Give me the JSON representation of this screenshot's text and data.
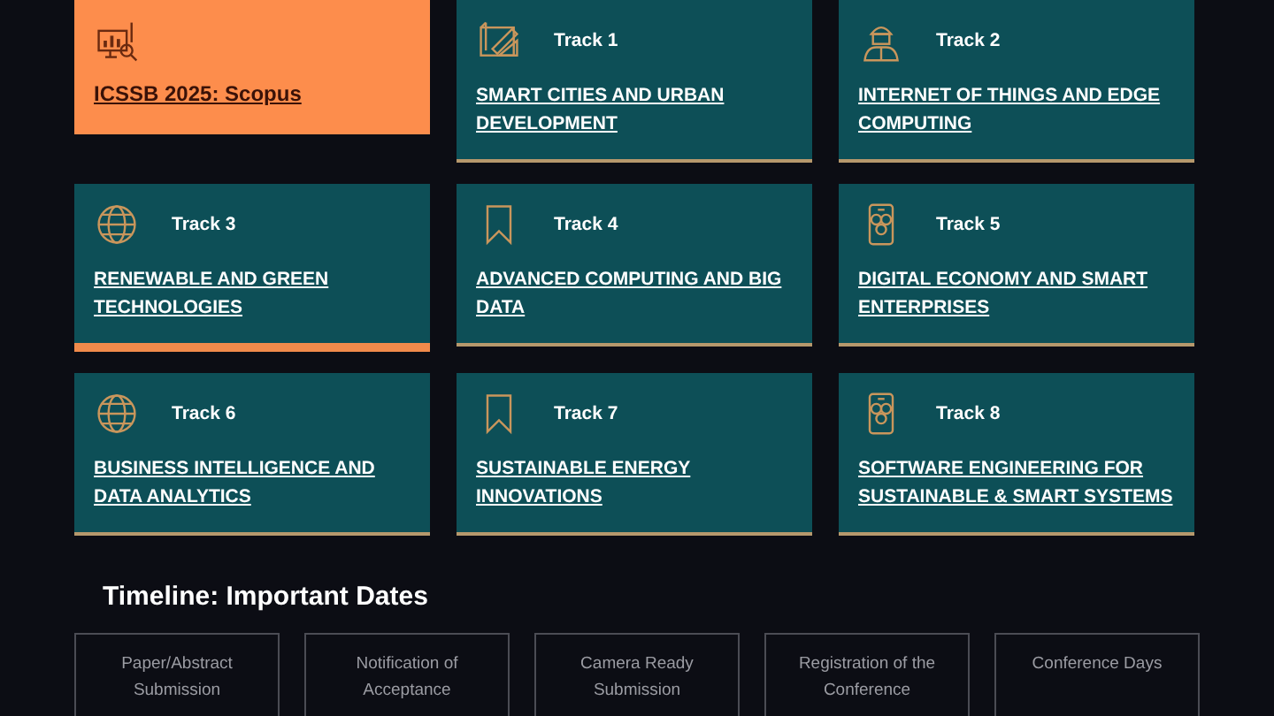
{
  "featured": {
    "title": "ICSSB 2025: Scopus"
  },
  "tracks": [
    {
      "label": "Track 1",
      "title": "SMART CITIES AND URBAN DEVELOPMENT",
      "highlighted": false
    },
    {
      "label": "Track 2",
      "title": "INTERNET OF THINGS AND EDGE COMPUTING",
      "highlighted": false
    },
    {
      "label": "Track 3",
      "title": "RENEWABLE AND GREEN TECHNOLOGIES",
      "highlighted": true
    },
    {
      "label": "Track 4",
      "title": "ADVANCED COMPUTING AND BIG DATA",
      "highlighted": false
    },
    {
      "label": "Track 5",
      "title": "DIGITAL ECONOMY AND SMART ENTERPRISES",
      "highlighted": false
    },
    {
      "label": "Track 6",
      "title": "BUSINESS INTELLIGENCE AND DATA ANALYTICS",
      "highlighted": false
    },
    {
      "label": "Track 7",
      "title": "SUSTAINABLE ENERGY INNOVATIONS",
      "highlighted": false
    },
    {
      "label": "Track 8",
      "title": "SOFTWARE ENGINEERING FOR SUSTAINABLE & SMART SYSTEMS",
      "highlighted": false
    }
  ],
  "timeline": {
    "title": "Timeline: Important Dates",
    "items": [
      "Paper/Abstract Submission",
      "Notification of Acceptance",
      "Camera Ready Submission",
      "Registration of the Conference",
      "Conference Days"
    ]
  }
}
